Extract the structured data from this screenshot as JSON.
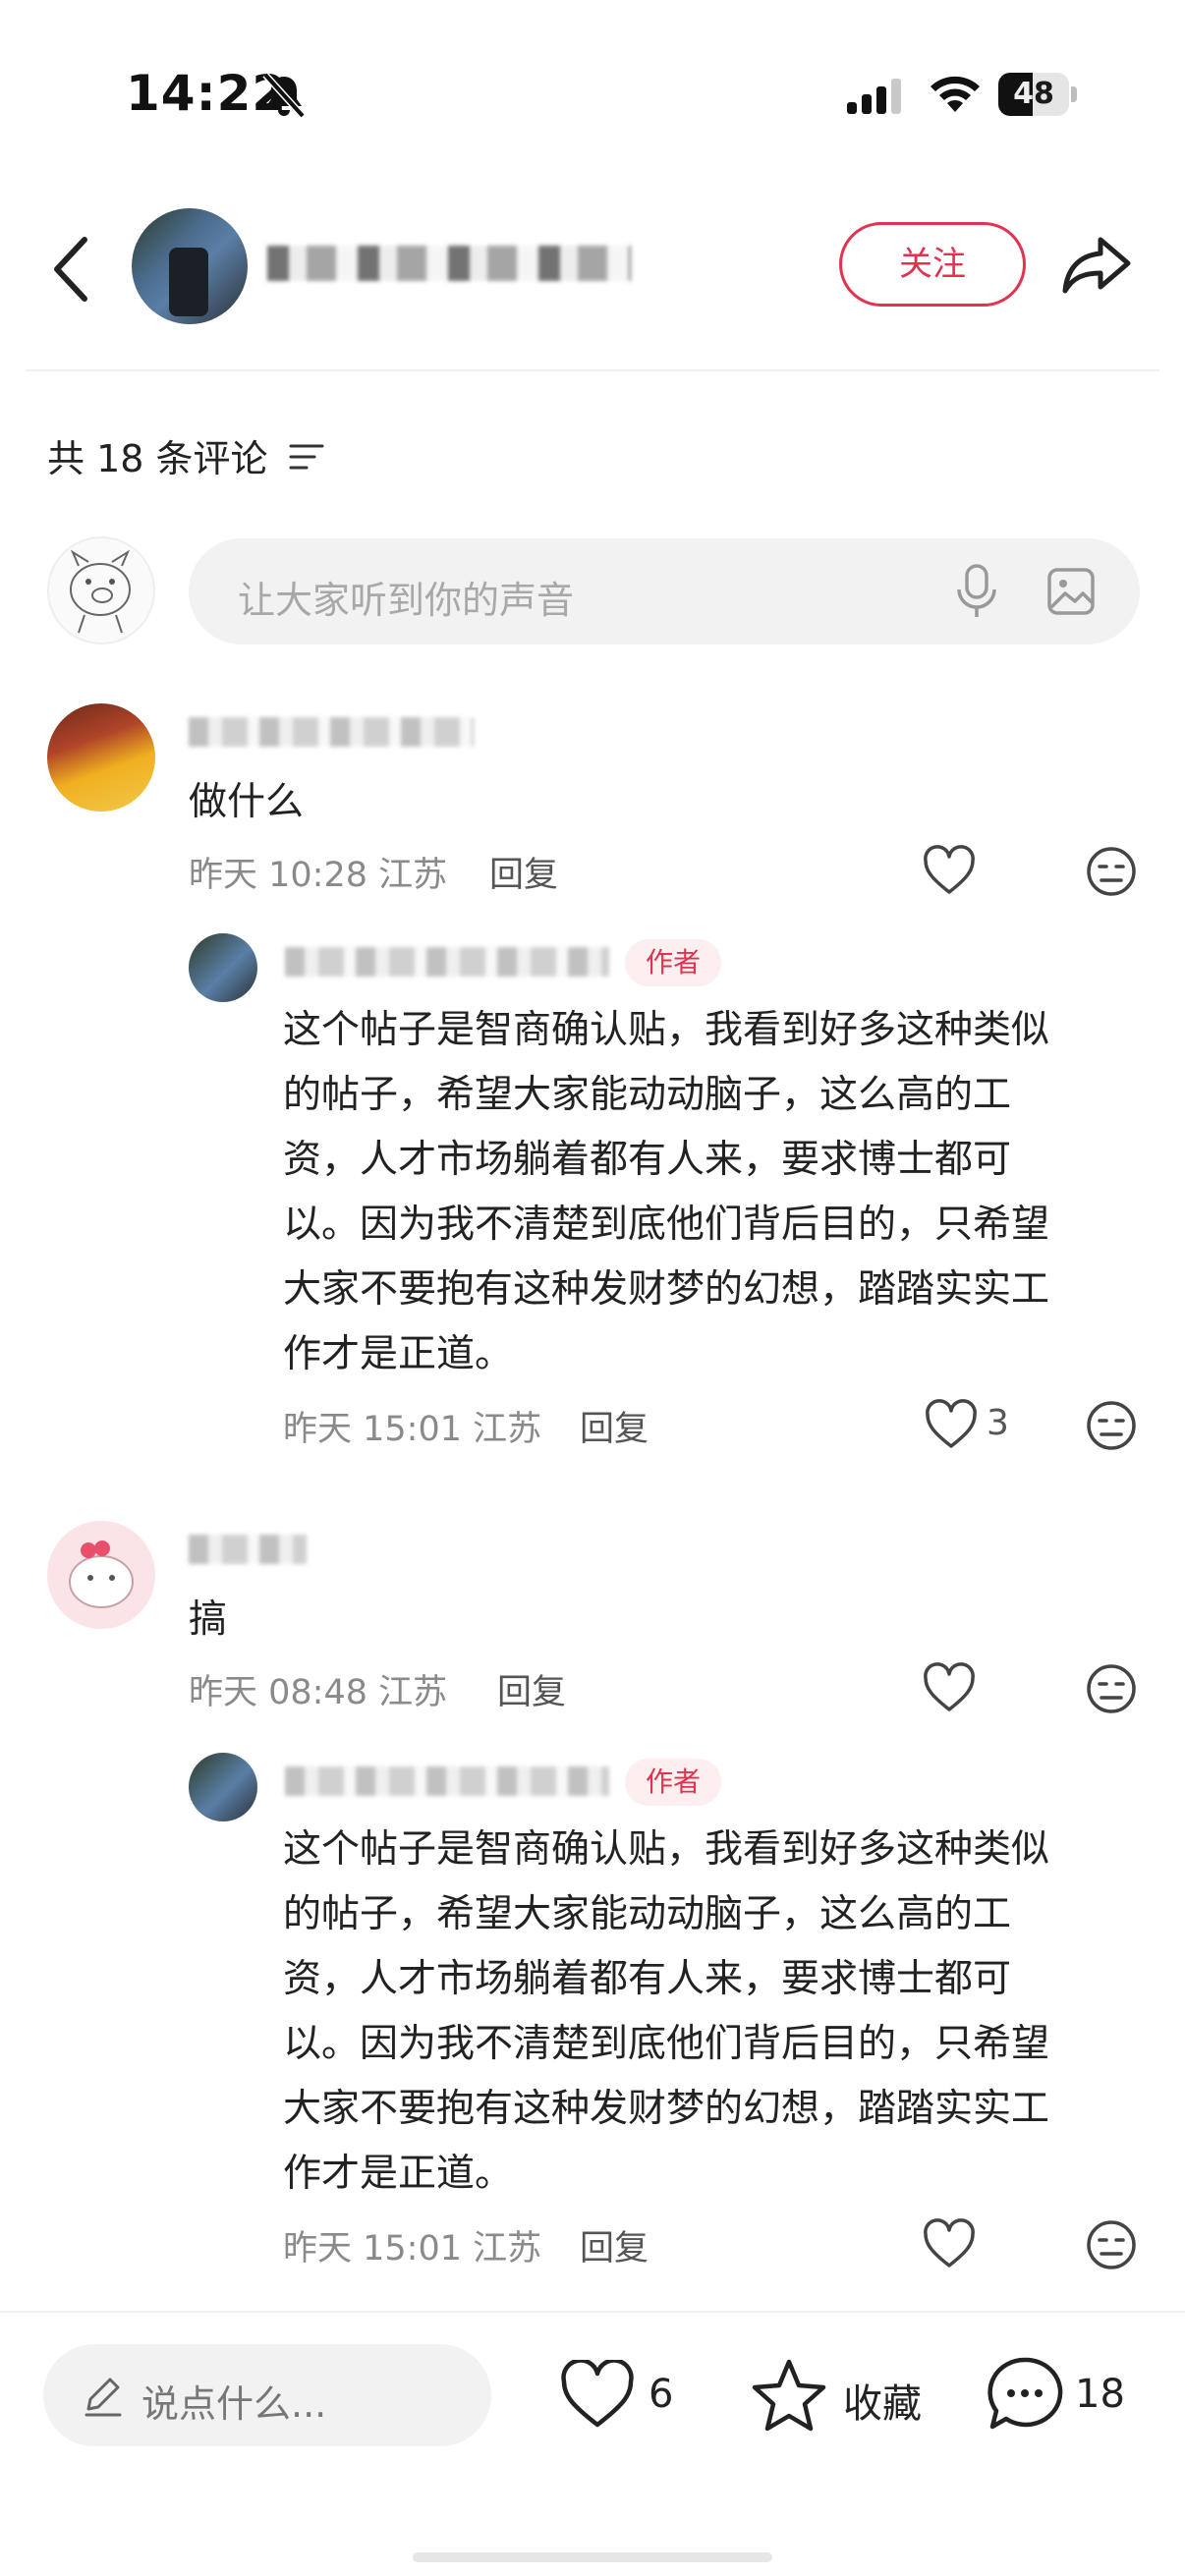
{
  "status_bar": {
    "time": "14:22",
    "battery": "48",
    "battery_level": 0.48
  },
  "header": {
    "follow_label": "关注"
  },
  "comments_header": {
    "count_text": "共 18 条评论"
  },
  "comment_input": {
    "placeholder": "让大家听到你的声音"
  },
  "comments": [
    {
      "text": "做什么",
      "meta": "昨天 10:28 江苏",
      "reply": "回复",
      "sub": {
        "badge": "作者",
        "lines": [
          "这个帖子是智商确认贴，我看到好多这种类似",
          "的帖子，希望大家能动动脑子，这么高的工",
          "资，人才市场躺着都有人来，要求博士都可",
          "以。因为我不清楚到底他们背后目的，只希望",
          "大家不要抱有这种发财梦的幻想，踏踏实实工",
          "作才是正道。"
        ],
        "meta": "昨天 15:01 江苏",
        "reply": "回复",
        "likes": "3"
      }
    },
    {
      "text": "搞",
      "meta": "昨天 08:48 江苏",
      "reply": "回复",
      "sub": {
        "badge": "作者",
        "lines": [
          "这个帖子是智商确认贴，我看到好多这种类似",
          "的帖子，希望大家能动动脑子，这么高的工",
          "资，人才市场躺着都有人来，要求博士都可",
          "以。因为我不清楚到底他们背后目的，只希望",
          "大家不要抱有这种发财梦的幻想，踏踏实实工",
          "作才是正道。"
        ],
        "meta": "昨天 15:01 江苏",
        "reply": "回复"
      }
    }
  ],
  "bottom_bar": {
    "input_placeholder": "说点什么...",
    "likes": "6",
    "collect_label": "收藏",
    "comments": "18"
  },
  "colors": {
    "accent": "#e0334f",
    "muted_text": "#8a8a8a",
    "input_bg": "#f2f2f2"
  }
}
